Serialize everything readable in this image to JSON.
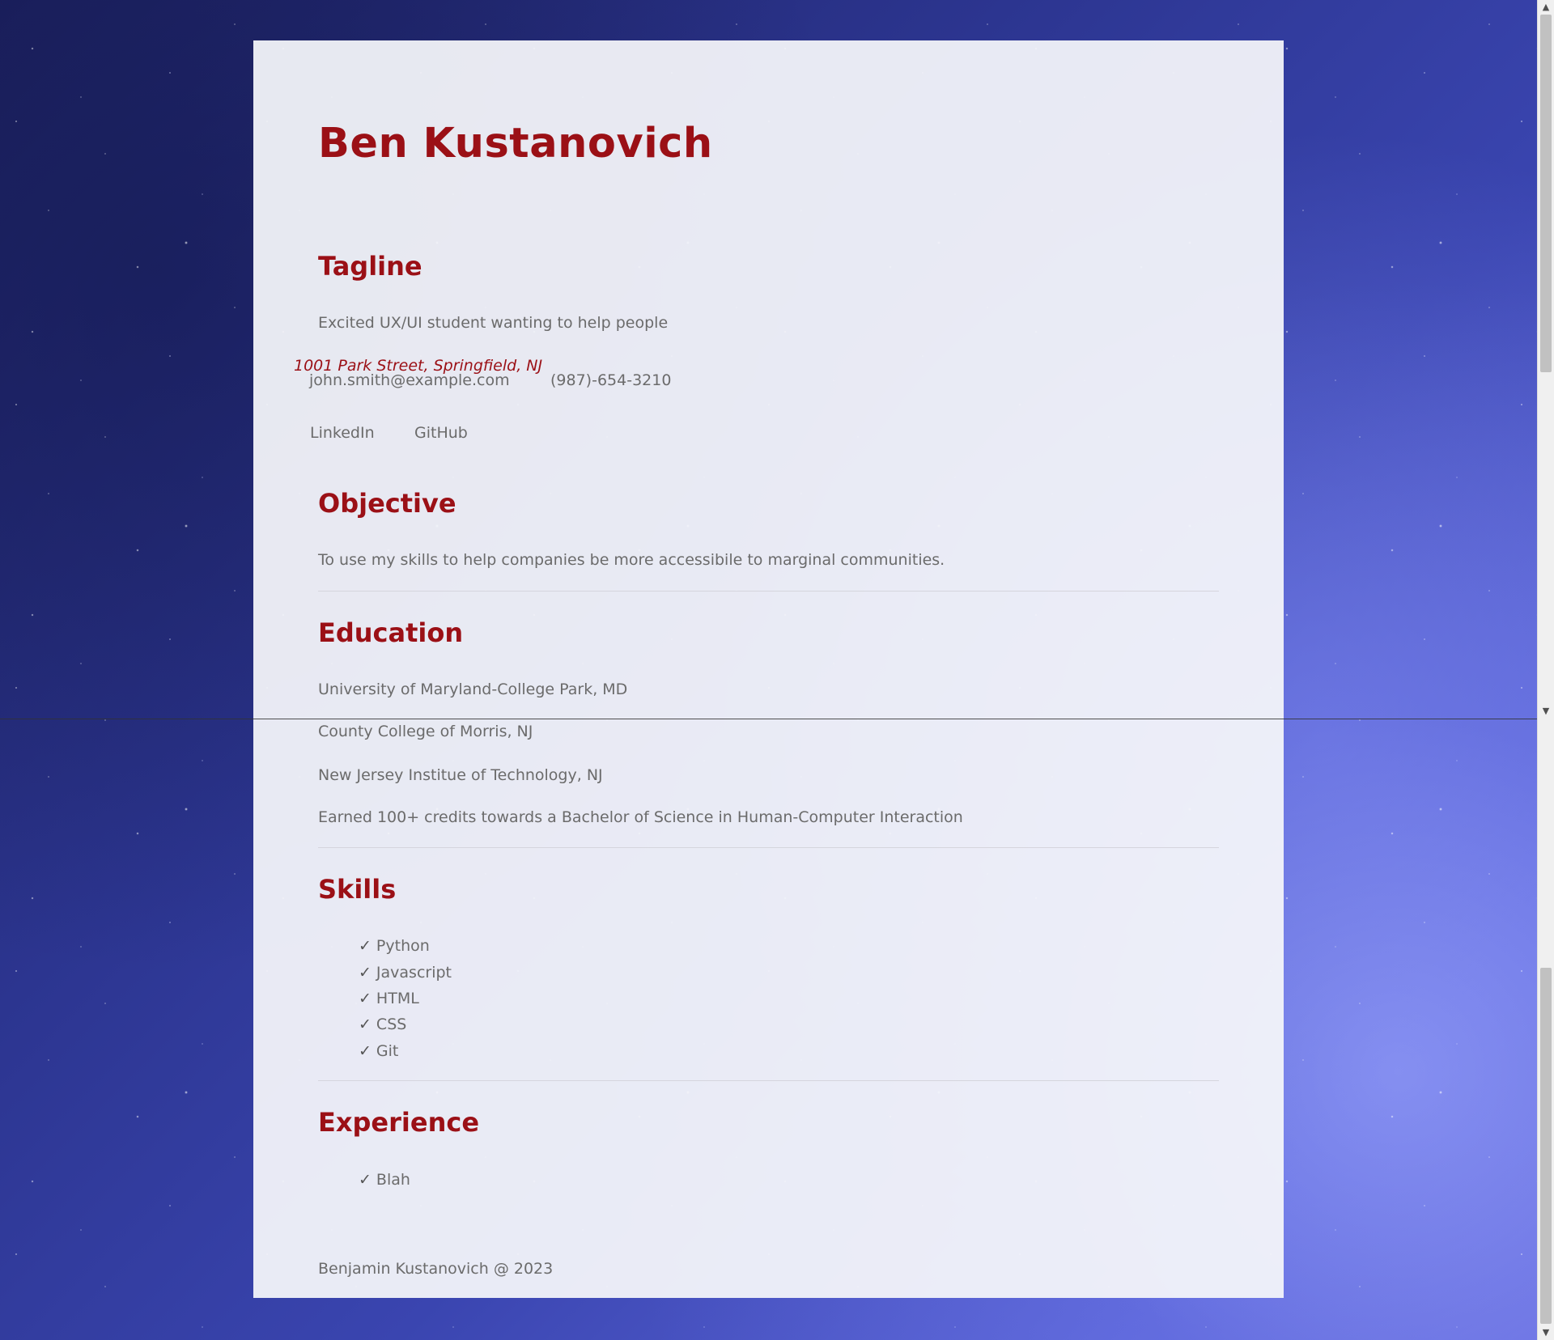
{
  "header": {
    "name": "Ben Kustanovich"
  },
  "tagline": {
    "title": "Tagline",
    "text": "Excited UX/UI student wanting to help people"
  },
  "contact": {
    "email": "john.smith@example.com",
    "phone": "(987)-654-3210",
    "address": "1001 Park Street, Springfield, NJ",
    "linkedin": "LinkedIn",
    "github": "GitHub"
  },
  "objective": {
    "title": "Objective",
    "text": "To use my skills to help companies be more accessibile to marginal communities."
  },
  "education": {
    "title": "Education",
    "items": [
      "University of Maryland-College Park, MD",
      "County College of Morris, NJ",
      "New Jersey Institue of Technology, NJ",
      "Earned 100+ credits towards a Bachelor of Science in Human-Computer Interaction"
    ]
  },
  "skills": {
    "title": "Skills",
    "check_glyph": "✓",
    "items": [
      "Python",
      "Javascript",
      "HTML",
      "CSS",
      "Git"
    ]
  },
  "experience": {
    "title": "Experience",
    "items": [
      "Blah"
    ]
  },
  "footer": {
    "text": "Benjamin Kustanovich @ 2023"
  },
  "scrollbar": {
    "up_arrow": "▲",
    "down_arrow": "▼"
  },
  "colors": {
    "accent": "#9b1016",
    "text": "#6b6b6b",
    "panel": "#f4f5fa"
  }
}
